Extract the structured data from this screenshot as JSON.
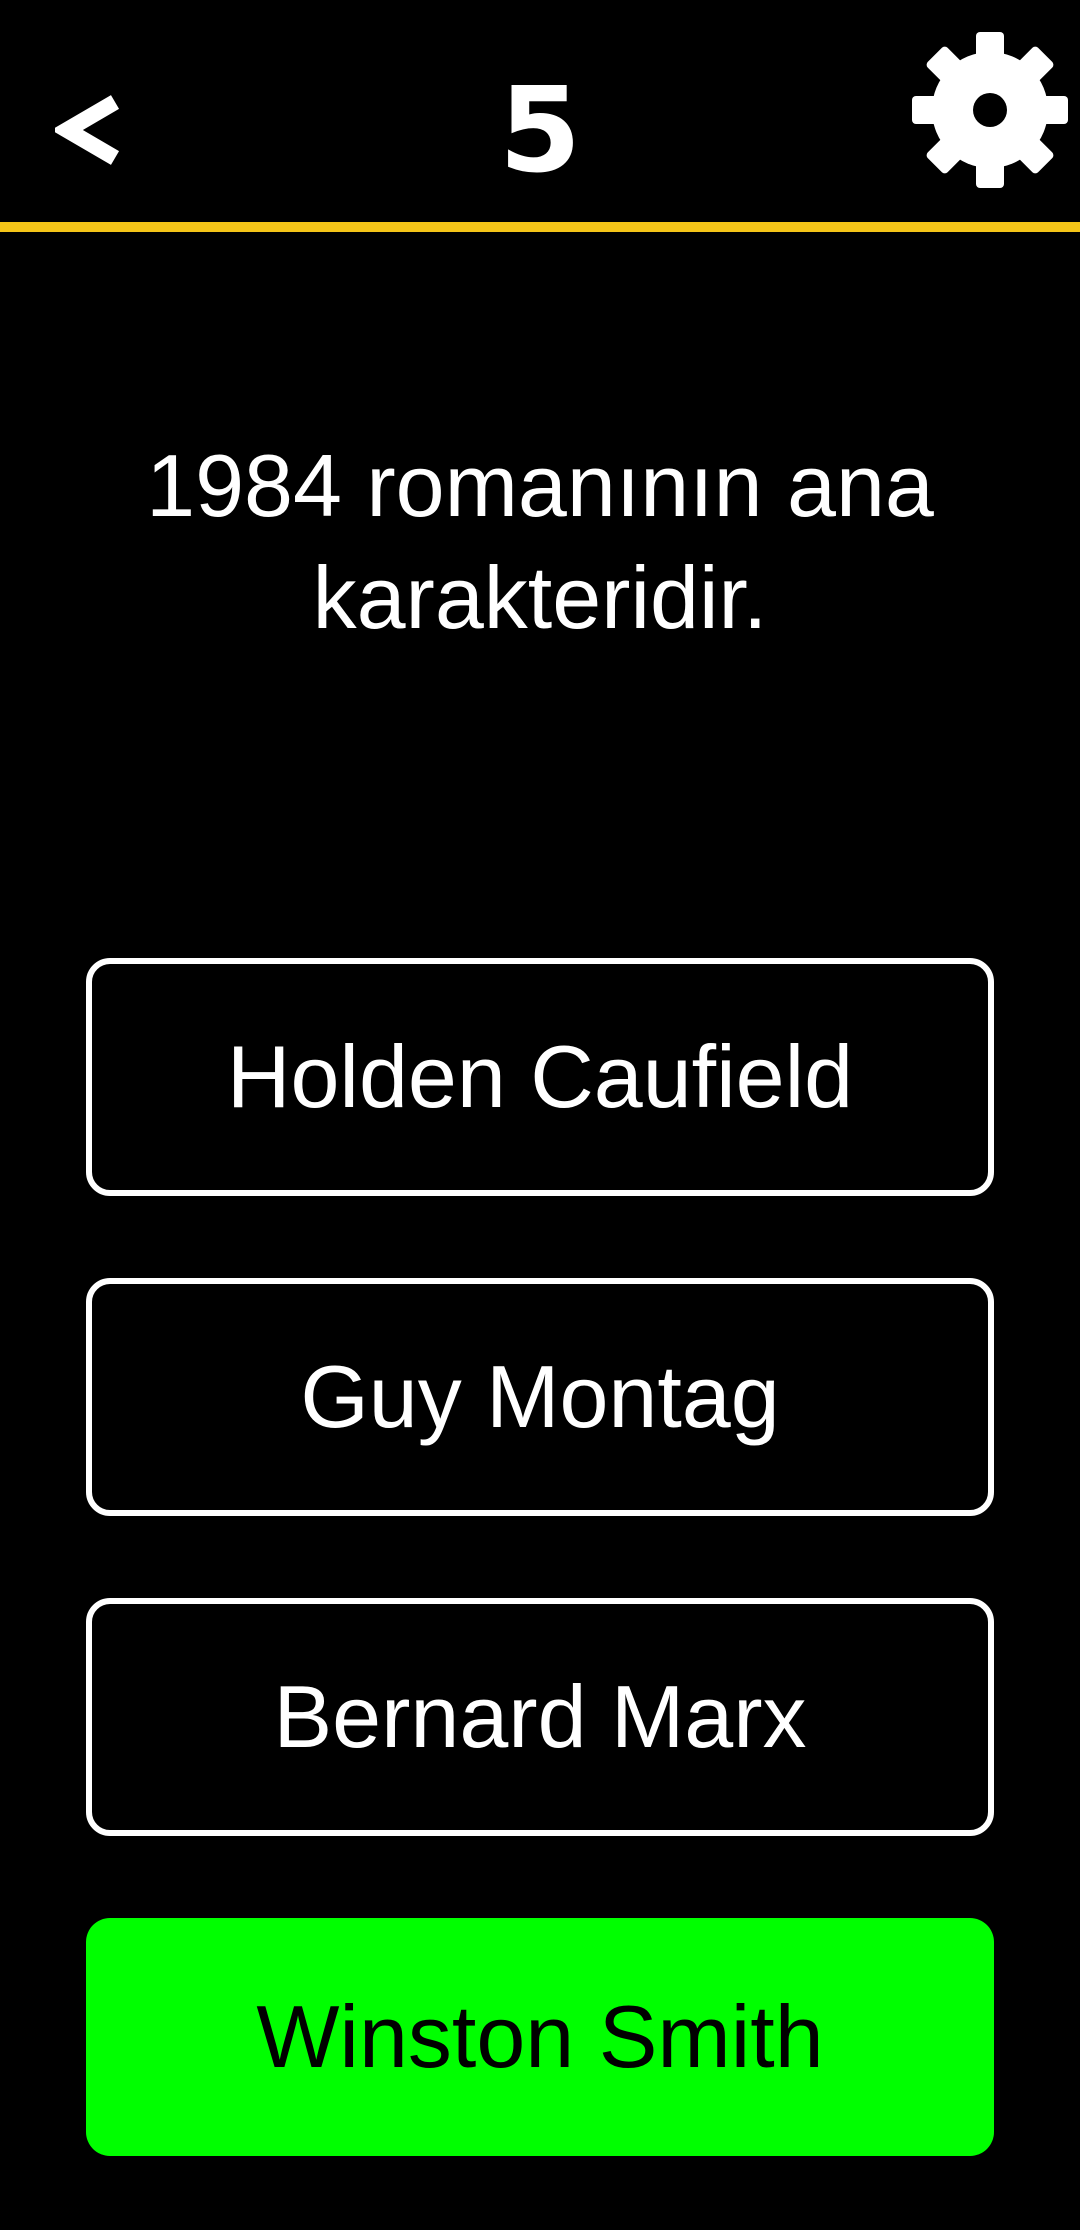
{
  "header": {
    "back_icon": "chevron-left-icon",
    "level": "5",
    "settings_icon": "gear-icon",
    "accent_color": "#F5C518"
  },
  "question": {
    "text": "1984 romanının ana karakteridir."
  },
  "answers": [
    {
      "label": "Holden Caufield",
      "state": "default"
    },
    {
      "label": "Guy Montag",
      "state": "default"
    },
    {
      "label": "Bernard Marx",
      "state": "default"
    },
    {
      "label": "Winston Smith",
      "state": "correct"
    }
  ],
  "colors": {
    "background": "#000000",
    "text": "#FFFFFF",
    "correct": "#00FF00"
  }
}
